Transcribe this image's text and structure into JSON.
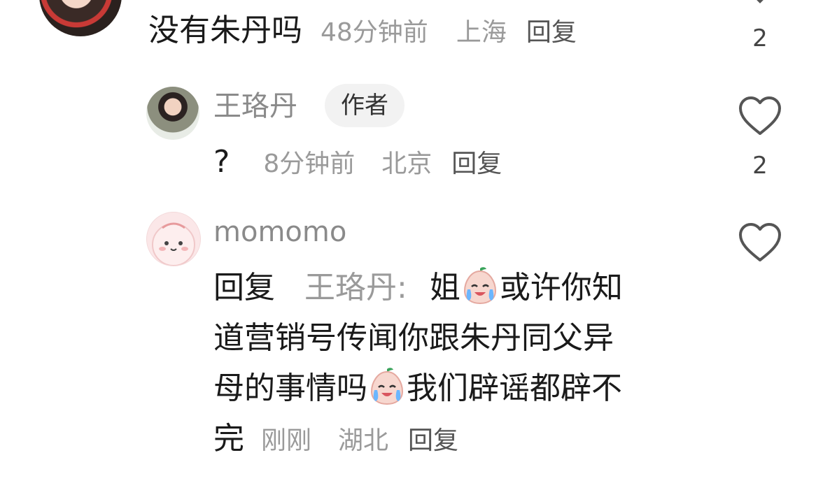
{
  "comments": [
    {
      "text": "没有朱丹吗",
      "time": "48分钟前",
      "location": "上海",
      "reply": "回复",
      "likes": "2"
    }
  ],
  "replies": [
    {
      "username": "王珞丹",
      "badge": "作者",
      "text": "?",
      "time": "8分钟前",
      "location": "北京",
      "reply": "回复",
      "likes": "2"
    },
    {
      "username": "momomo",
      "reply_prefix": "回复",
      "reply_to": "王珞丹",
      "colon": ":",
      "line1_a": "姐",
      "line1_b": "或许你知",
      "line2": "道营销号传闻你跟朱丹同父异",
      "line3_a": "母的事情吗",
      "line3_b": "我们辟谣都辟不",
      "line4": "完",
      "time": "刚刚",
      "location": "湖北",
      "reply": "回复",
      "emoji": "crying-face-emoji"
    }
  ],
  "colors": {
    "text": "#1a1a1a",
    "meta": "#9a9a9a",
    "username": "#8a8a8a",
    "badge_bg": "#f2f2f2"
  }
}
